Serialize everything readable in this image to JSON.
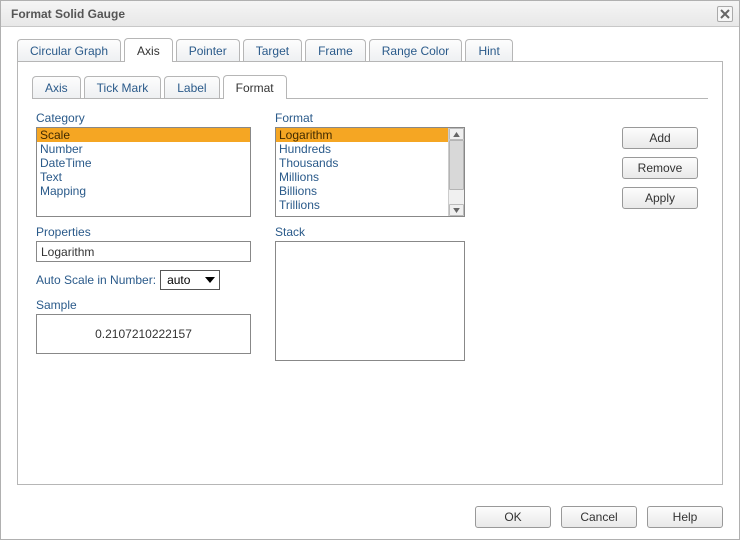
{
  "title": "Format Solid Gauge",
  "main_tabs": {
    "items": [
      "Circular Graph",
      "Axis",
      "Pointer",
      "Target",
      "Frame",
      "Range Color",
      "Hint"
    ],
    "active_index": 1
  },
  "axis_sub_tabs": {
    "items": [
      "Axis",
      "Tick Mark",
      "Label",
      "Format"
    ],
    "active_index": 3
  },
  "labels": {
    "category": "Category",
    "format": "Format",
    "properties": "Properties",
    "auto_scale": "Auto Scale in Number:",
    "sample": "Sample",
    "stack": "Stack"
  },
  "category_list": {
    "items": [
      "Scale",
      "Number",
      "DateTime",
      "Text",
      "Mapping"
    ],
    "selected_index": 0
  },
  "format_list": {
    "items": [
      "Logarithm",
      "Hundreds",
      "Thousands",
      "Millions",
      "Billions",
      "Trillions"
    ],
    "selected_index": 0
  },
  "properties_value": "Logarithm",
  "auto_scale_value": "auto",
  "sample_value": "0.2107210222157",
  "side_buttons": {
    "add": "Add",
    "remove": "Remove",
    "apply": "Apply"
  },
  "footer_buttons": {
    "ok": "OK",
    "cancel": "Cancel",
    "help": "Help"
  }
}
